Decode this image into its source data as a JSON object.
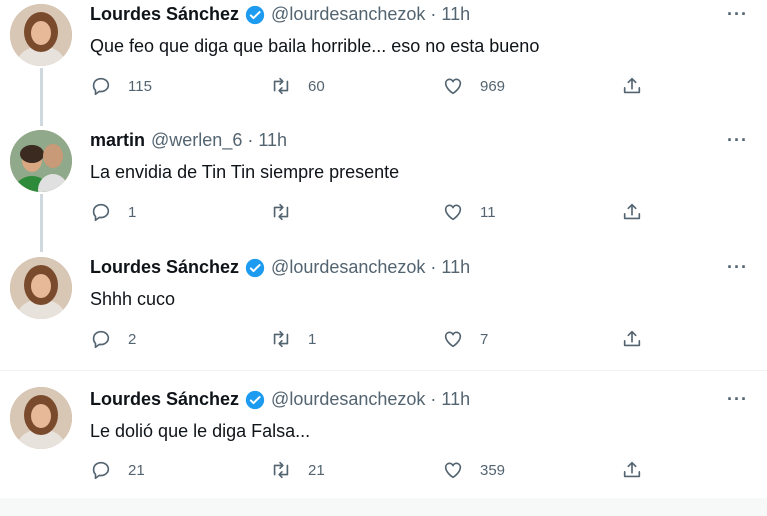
{
  "tweets": [
    {
      "name": "Lourdes Sánchez",
      "verified": true,
      "handle": "@lourdesanchezok",
      "time": "11h",
      "text": "Que feo que diga que baila horrible... eso no esta bueno",
      "replies": "115",
      "retweets": "60",
      "likes": "969"
    },
    {
      "name": "martin",
      "verified": false,
      "handle": "@werlen_6",
      "time": "11h",
      "text": "La envidia de Tin Tin siempre presente",
      "replies": "1",
      "retweets": "",
      "likes": "11"
    },
    {
      "name": "Lourdes Sánchez",
      "verified": true,
      "handle": "@lourdesanchezok",
      "time": "11h",
      "text": "Shhh cuco",
      "replies": "2",
      "retweets": "1",
      "likes": "7"
    },
    {
      "name": "Lourdes Sánchez",
      "verified": true,
      "handle": "@lourdesanchezok",
      "time": "11h",
      "text": "Le dolió que le diga Falsa...",
      "replies": "21",
      "retweets": "21",
      "likes": "359"
    }
  ],
  "separator": "·",
  "more_label": "···",
  "colors": {
    "verified": "#1d9bf0",
    "secondary": "#536471",
    "thread_line": "#cfd9de"
  },
  "icons": {
    "reply": "reply-icon",
    "retweet": "retweet-icon",
    "like": "heart-icon",
    "share": "share-icon",
    "verified": "verified-badge-icon"
  }
}
